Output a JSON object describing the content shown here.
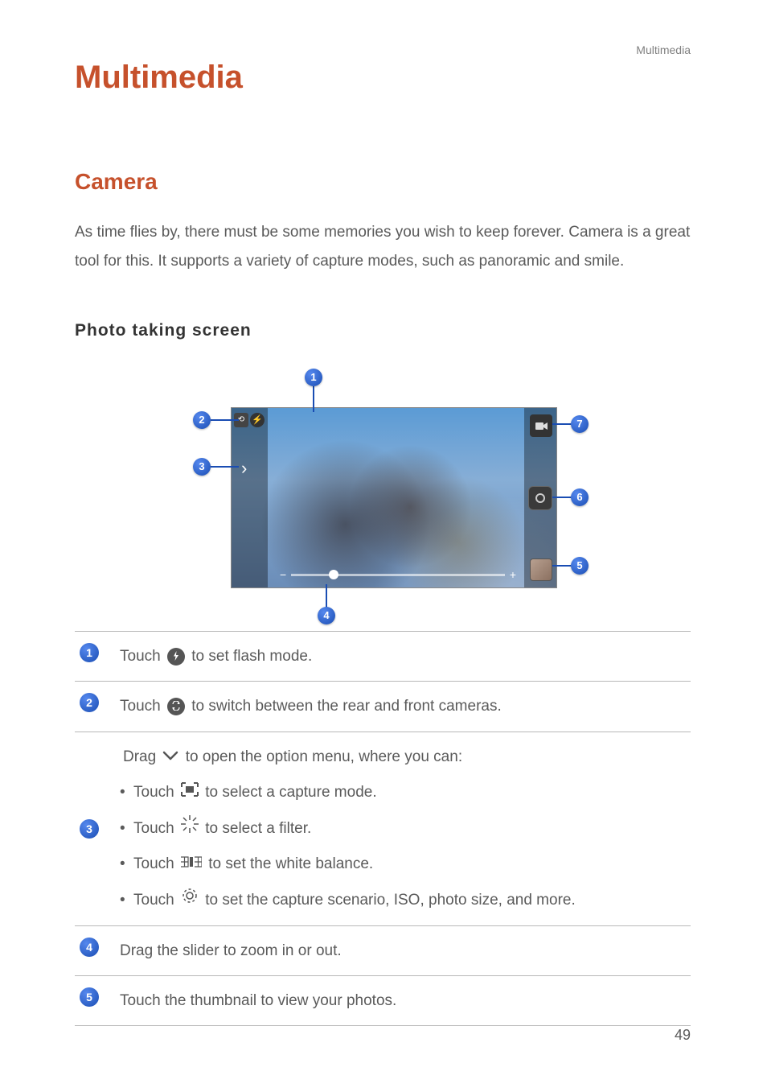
{
  "header": {
    "right": "Multimedia"
  },
  "title": "Multimedia",
  "section": "Camera",
  "intro": "As time flies by, there must be some memories you wish to keep forever. Camera is a great tool for this. It supports a variety of capture modes, such as panoramic and smile.",
  "subsection": "Photo taking screen",
  "zoom": {
    "minus": "−",
    "plus": "+"
  },
  "callouts": {
    "c1": "1",
    "c2": "2",
    "c3": "3",
    "c4": "4",
    "c5": "5",
    "c6": "6",
    "c7": "7"
  },
  "table": {
    "r1": {
      "num": "1",
      "pre": "Touch ",
      "post": " to set flash mode."
    },
    "r2": {
      "num": "2",
      "pre": "Touch ",
      "post": " to switch between the rear and front cameras."
    },
    "r3": {
      "num": "3",
      "intro_pre": "Drag ",
      "intro_post": " to open the option menu, where you can:",
      "b1_pre": "Touch ",
      "b1_post": "to select a capture mode.",
      "b2_pre": "Touch ",
      "b2_post": " to select a filter.",
      "b3_pre": "Touch ",
      "b3_post": " to set the white balance.",
      "b4_pre": "Touch ",
      "b4_post": " to set the capture scenario, ISO, photo size, and more."
    },
    "r4": {
      "num": "4",
      "text": "Drag the slider to zoom in or out."
    },
    "r5": {
      "num": "5",
      "text": "Touch the thumbnail to view your photos."
    }
  },
  "page_number": "49",
  "chart_data": {
    "type": "table",
    "title": "Photo taking screen callouts",
    "rows": [
      {
        "marker": 1,
        "description": "Touch [flash-icon] to set flash mode."
      },
      {
        "marker": 2,
        "description": "Touch [switch-camera-icon] to switch between the rear and front cameras."
      },
      {
        "marker": 3,
        "description": "Drag [chevron-down] to open the option menu, where you can: Touch [capture-mode-icon] to select a capture mode; Touch [filter-icon] to select a filter; Touch [white-balance-icon] to set the white balance; Touch [settings-gear-icon] to set the capture scenario, ISO, photo size, and more."
      },
      {
        "marker": 4,
        "description": "Drag the slider to zoom in or out."
      },
      {
        "marker": 5,
        "description": "Touch the thumbnail to view your photos."
      }
    ]
  }
}
